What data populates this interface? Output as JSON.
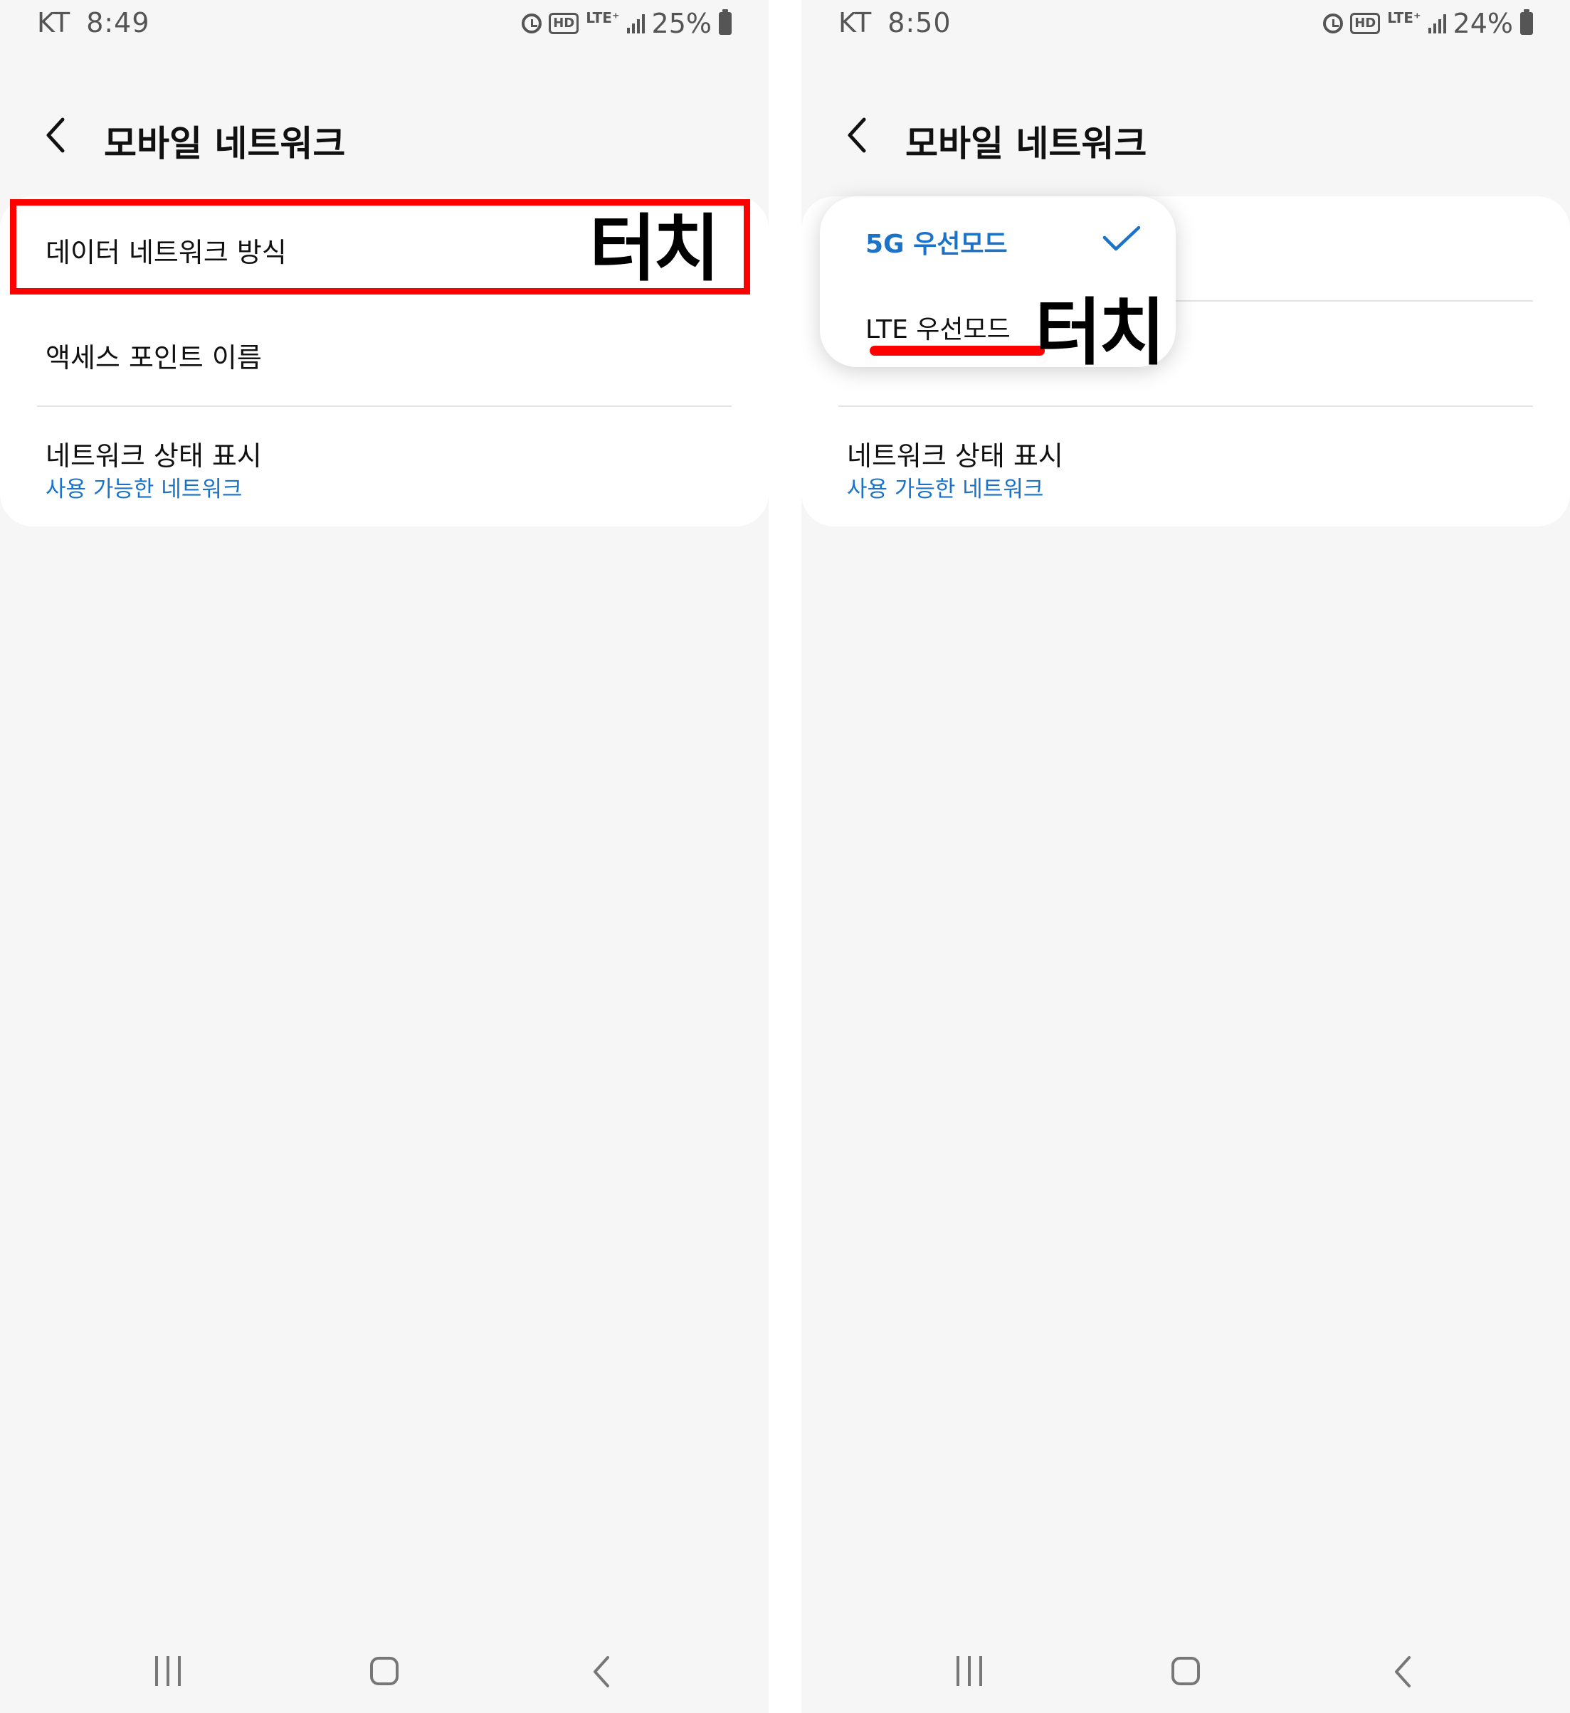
{
  "left": {
    "status": {
      "carrier": "KT",
      "time": "8:49",
      "hd": "HD",
      "lte": "LTE⁺",
      "battery": "25%"
    },
    "header": {
      "title": "모바일 네트워크"
    },
    "list": {
      "item1": "데이터 네트워크 방식",
      "item2": "액세스 포인트 이름",
      "item3_title": "네트워크 상태 표시",
      "item3_sub": "사용 가능한 네트워크"
    },
    "annotation": {
      "label": "터치"
    }
  },
  "right": {
    "status": {
      "carrier": "KT",
      "time": "8:50",
      "hd": "HD",
      "lte": "LTE⁺",
      "battery": "24%"
    },
    "header": {
      "title": "모바일 네트워크"
    },
    "popup": {
      "option1": "5G 우선모드",
      "option2": "LTE 우선모드",
      "selected": "option1"
    },
    "list": {
      "item3_title": "네트워크 상태 표시",
      "item3_sub": "사용 가능한 네트워크"
    },
    "annotation": {
      "label": "터치"
    }
  },
  "colors": {
    "accent": "#1a73c8",
    "annotation": "#ff0000",
    "background": "#f6f6f6",
    "card": "#ffffff"
  },
  "icons": {
    "status": [
      "alarm-icon",
      "hd-voice-icon",
      "lte-plus-icon",
      "signal-icon",
      "battery-icon"
    ],
    "header": "back-chevron-icon",
    "popup": "checkmark-icon",
    "nav": [
      "recent-apps-icon",
      "home-icon",
      "nav-back-icon"
    ]
  }
}
